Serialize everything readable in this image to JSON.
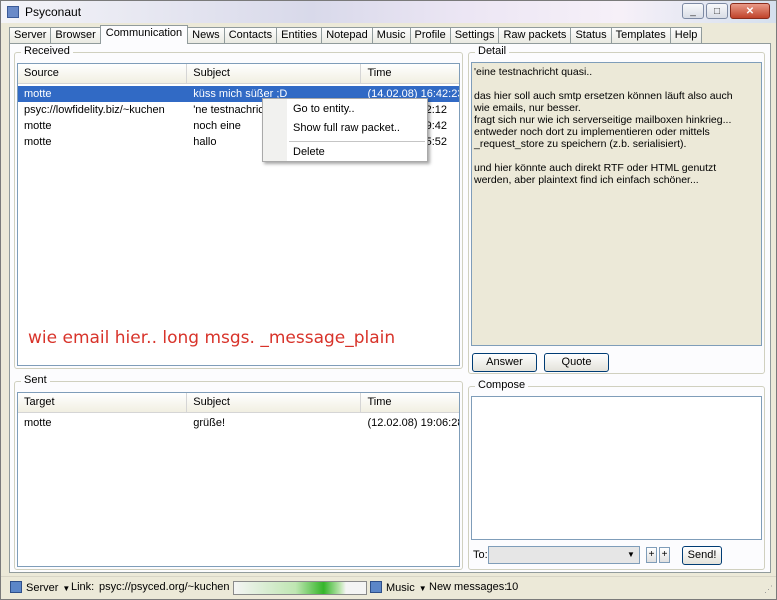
{
  "window": {
    "title": "Psyconaut",
    "minimize": "_",
    "maximize": "□",
    "close": "✕"
  },
  "tabs": [
    {
      "label": "Server"
    },
    {
      "label": "Browser"
    },
    {
      "label": "Communication"
    },
    {
      "label": "News"
    },
    {
      "label": "Contacts"
    },
    {
      "label": "Entities"
    },
    {
      "label": "Notepad"
    },
    {
      "label": "Music"
    },
    {
      "label": "Profile"
    },
    {
      "label": "Settings"
    },
    {
      "label": "Raw packets"
    },
    {
      "label": "Status"
    },
    {
      "label": "Templates"
    },
    {
      "label": "Help"
    }
  ],
  "active_tab": "Communication",
  "received": {
    "label": "Received",
    "columns": [
      "Source",
      "Subject",
      "Time"
    ],
    "rows": [
      {
        "source": "motte",
        "subject": "küss mich süßer ;D",
        "time": "(14.02.08) 16:42:23"
      },
      {
        "source": "psyc://lowfidelity.biz/~kuchen",
        "subject": "'ne testnachricht",
        "time": "2:12"
      },
      {
        "source": "motte",
        "subject": "noch eine",
        "time": "9:42"
      },
      {
        "source": "motte",
        "subject": "hallo",
        "time": "5:52"
      }
    ]
  },
  "context_menu": {
    "items": [
      "Go to entity..",
      "Show full raw packet..",
      "Delete"
    ]
  },
  "annotation": "wie email hier.. long msgs. _message_plain",
  "detail": {
    "label": "Detail",
    "text": "'eine testnachricht quasi..\n\ndas hier soll auch smtp ersetzen können läuft also auch\nwie emails, nur besser.\nfragt sich nur wie ich serverseitige mailboxen hinkrieg...\nentweder noch dort zu implementieren oder mittels\n_request_store zu speichern (z.b. serialisiert).\n\nund hier könnte auch direkt RTF oder HTML genutzt\nwerden, aber plaintext find ich einfach schöner...",
    "answer_label": "Answer",
    "quote_label": "Quote"
  },
  "sent": {
    "label": "Sent",
    "columns": [
      "Target",
      "Subject",
      "Time"
    ],
    "rows": [
      {
        "target": "motte",
        "subject": "grüße!",
        "time": "(12.02.08) 19:06:28"
      }
    ]
  },
  "compose": {
    "label": "Compose",
    "to_label": "To:",
    "to_value": "",
    "plus1": "+",
    "plus2": "+",
    "send_label": "Send!"
  },
  "statusbar": {
    "server_label": "Server",
    "link_label": "Link:",
    "link_value": "psyc://psyced.org/~kuchen",
    "progress_fraction": 0.85,
    "music_label": "Music",
    "new_messages_label": "New messages:",
    "new_messages_count": "10"
  }
}
